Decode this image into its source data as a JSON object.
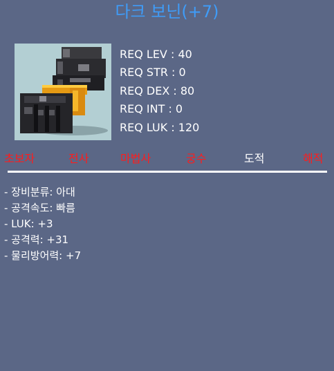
{
  "item": {
    "name": "다크 보닌(+7)",
    "icon": "dark-gauntlet-icon"
  },
  "requirements": [
    "REQ LEV : 40",
    "REQ STR : 0",
    "REQ DEX : 80",
    "REQ INT : 0",
    "REQ LUK : 120"
  ],
  "jobs": [
    {
      "label": "초보자",
      "color": "#ff1c1c"
    },
    {
      "label": "전사",
      "color": "#ff1c1c"
    },
    {
      "label": "마법사",
      "color": "#ff1c1c"
    },
    {
      "label": "궁수",
      "color": "#ff1c1c"
    },
    {
      "label": "도적",
      "color": "#ffffff"
    },
    {
      "label": "해적",
      "color": "#ff1c1c"
    }
  ],
  "stats": [
    "- 장비분류: 아대",
    "- 공격속도: 빠름",
    "- LUK: +3",
    "- 공격력: +31",
    "- 물리방어력: +7"
  ],
  "colors": {
    "background": "#5b6786",
    "title": "#3f9cf8",
    "unavailable_job": "#ff1c1c",
    "available_job": "#ffffff"
  }
}
